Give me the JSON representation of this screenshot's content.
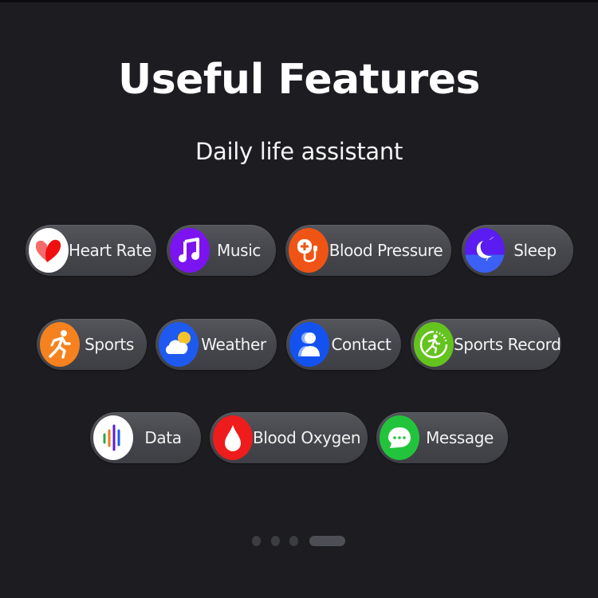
{
  "header": {
    "title": "Useful Features",
    "subtitle": "Daily life assistant"
  },
  "features": [
    {
      "label": "Heart Rate",
      "icon": "heart-icon",
      "icon_bg": "#ffffff"
    },
    {
      "label": "Music",
      "icon": "music-note-icon",
      "icon_bg": "#7b14f0"
    },
    {
      "label": "Blood Pressure",
      "icon": "blood-pressure-icon",
      "icon_bg": "#f05414"
    },
    {
      "label": "Sleep",
      "icon": "moon-icon",
      "icon_bg": "#5a2cf0"
    },
    {
      "label": "Sports",
      "icon": "running-icon",
      "icon_bg": "#f5821e"
    },
    {
      "label": "Weather",
      "icon": "cloud-sun-icon",
      "icon_bg": "#1e5af0"
    },
    {
      "label": "Contact",
      "icon": "person-icon",
      "icon_bg": "#1452f0"
    },
    {
      "label": "Sports Record",
      "icon": "sports-record-icon",
      "icon_bg": "#64c31e"
    },
    {
      "label": "Data",
      "icon": "bar-data-icon",
      "icon_bg": "#ffffff"
    },
    {
      "label": "Blood Oxygen",
      "icon": "blood-drop-icon",
      "icon_bg": "#ee1c1c"
    },
    {
      "label": "Message",
      "icon": "chat-bubble-icon",
      "icon_bg": "#22c43c"
    }
  ],
  "pagination": {
    "total_pages": 4,
    "current_page": 4
  }
}
